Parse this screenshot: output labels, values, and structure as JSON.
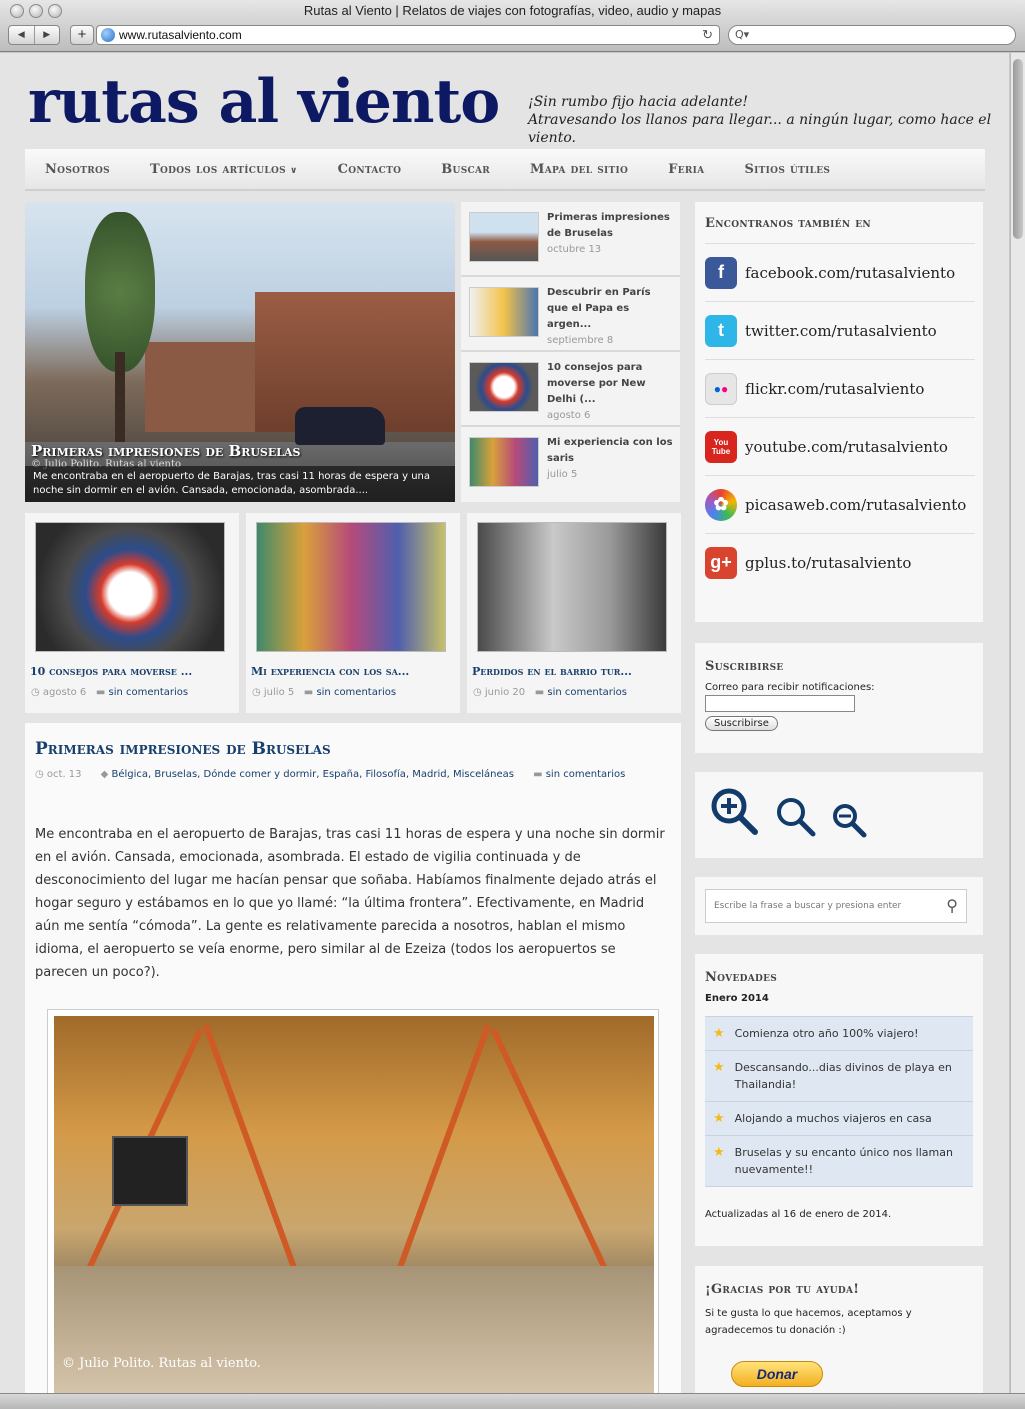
{
  "window": {
    "title": "Rutas al Viento | Relatos de viajes con fotografías, video, audio y mapas",
    "url": "www.rutasalviento.com",
    "back_icon": "◀",
    "forward_icon": "▶",
    "new_tab_icon": "+",
    "reload_icon": "↻",
    "search_icon": "Q▾"
  },
  "header": {
    "logo": "rutas al viento",
    "tagline_1": "¡Sin rumbo fijo hacia adelante!",
    "tagline_2": "Atravesando los llanos para llegar...  a ningún lugar, como hace el viento."
  },
  "menu": {
    "items": [
      "Nosotros",
      "Todos los artículos",
      "Contacto",
      "Buscar",
      "Mapa del sitio",
      "Feria",
      "Sitios útiles"
    ],
    "dropdown_icon": "∨"
  },
  "hero": {
    "title": "Primeras impresiones de Bruselas",
    "watermark": "© Julio Polito. Rutas al viento",
    "excerpt": "Me encontraba en el aeropuerto de Barajas, tras casi 11 horas de espera y una noche sin dormir en el avión. Cansada, emocionada, asombrada...."
  },
  "slider_list": [
    {
      "title": "Primeras impresiones de Bruselas",
      "date": "octubre 13"
    },
    {
      "title": "Descubrir en París que el Papa es argen...",
      "date": "septiembre 8"
    },
    {
      "title": "10 consejos para moverse por New Delhi (...",
      "date": "agosto 6"
    },
    {
      "title": "Mi experiencia con los saris",
      "date": "julio 5"
    }
  ],
  "cards": [
    {
      "title": "10 consejos para moverse ...",
      "date": "agosto 6",
      "comments": "sin comentarios"
    },
    {
      "title": "Mi experiencia con los sa...",
      "date": "julio 5",
      "comments": "sin comentarios"
    },
    {
      "title": "Perdidos en el barrio tur...",
      "date": "junio 20",
      "comments": "sin comentarios"
    }
  ],
  "post": {
    "title": "Primeras impresiones de Bruselas",
    "date": "oct. 13",
    "tags": "Bélgica, Bruselas, Dónde comer y dormir, España, Filosofía, Madrid, Misceláneas",
    "comments": "sin comentarios",
    "body": "Me encontraba en el aeropuerto de Barajas, tras casi 11 horas de espera y una noche sin dormir en el avión. Cansada, emocionada, asombrada. El estado de vigilia continuada y de desconocimiento del lugar me hacían pensar que soñaba. Habíamos finalmente dejado atrás el hogar seguro y estábamos en lo que yo llamé: “la última frontera”. Efectivamente, en Madrid aún me sentía “cómoda”. La gente es relativamente parecida a nosotros, hablan el mismo idioma, el aeropuerto se veía enorme, pero similar al de Ezeiza (todos los aeropuertos se parecen un poco?).",
    "image_watermark": "© Julio Polito. Rutas al viento."
  },
  "sidebar": {
    "social_title": "Encontranos también en",
    "social": [
      {
        "icon": "f",
        "text": "facebook.com/rutasalviento",
        "color": "#3b5998"
      },
      {
        "icon": "t",
        "text": "twitter.com/rutasalviento",
        "color": "#2fb6e8"
      },
      {
        "icon": "●●",
        "text": "flickr.com/rutasalviento",
        "color": "#e6e6e6"
      },
      {
        "icon": "You Tube",
        "text": "youtube.com/rutasalviento",
        "color": "#d8261f"
      },
      {
        "icon": "✿",
        "text": "picasaweb.com/rutasalviento",
        "color": "#9c5bc7"
      },
      {
        "icon": "g+",
        "text": "gplus.to/rutasalviento",
        "color": "#d9442f"
      }
    ],
    "subscribe_title": "Suscribirse",
    "subscribe_label": "Correo para recibir notificaciones:",
    "subscribe_button": "Suscribirse",
    "search_placeholder": "Escribe la frase a buscar y presiona enter",
    "novedades_title": "Novedades",
    "novedades_month": "Enero 2014",
    "novedades": [
      "Comienza otro año 100% viajero!",
      "Descansando...dias divinos de playa en Thailandia!",
      "Alojando a muchos viajeros en casa",
      "Bruselas y su encanto único nos llaman nuevamente!!"
    ],
    "novedades_updated": "Actualizadas al 16 de enero de 2014.",
    "donate_title": "¡Gracias por tu ayuda!",
    "donate_text": "Si te gusta lo que hacemos, aceptamos y agradecemos tu donación :)",
    "donate_button": "Donar"
  },
  "colors": {
    "logo": "#0d1a63",
    "link": "#18406c",
    "star": "#f3bb19"
  }
}
